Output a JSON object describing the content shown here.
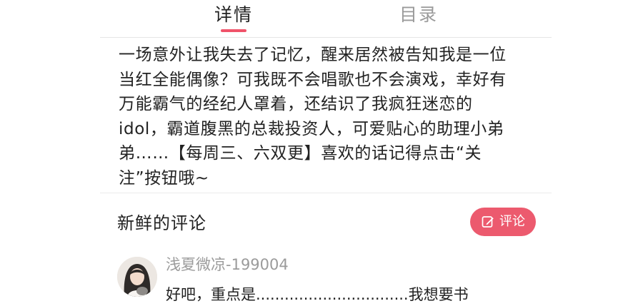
{
  "tabs": [
    {
      "label": "详情",
      "active": true
    },
    {
      "label": "目录",
      "active": false
    }
  ],
  "intro": {
    "text": "一场意外让我失去了记忆，醒来居然被告知我是一位\n当红全能偶像？可我既不会唱歌也不会演戏，幸好有\n万能霸气的经纪人罩着，还结识了我疯狂迷恋的\nidol，霸道腹黑的总裁投资人，可爱贴心的助理小弟\n弟……【每周三、六双更】喜欢的话记得点击“关\n注”按钮哦~"
  },
  "comments": {
    "title": "新鲜的评论",
    "button_label": "评论",
    "button_icon": "edit-icon",
    "items": [
      {
        "user": "浅夏微凉-199004",
        "text": "好吧，重点是................................我想要书",
        "avatar": "user-avatar"
      }
    ]
  },
  "colors": {
    "accent": "#ec5a6e",
    "tab_active": "#222222",
    "tab_inactive": "#9a9a9a",
    "username": "#9b9b9b"
  }
}
